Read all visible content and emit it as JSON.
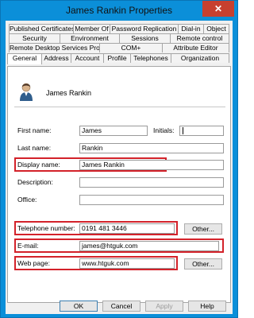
{
  "window": {
    "title": "James Rankin Properties",
    "close_glyph": "✕"
  },
  "tabs": {
    "row1": [
      "Published Certificates",
      "Member Of",
      "Password Replication",
      "Dial-in",
      "Object"
    ],
    "row2": [
      "Security",
      "Environment",
      "Sessions",
      "Remote control"
    ],
    "row3": [
      "Remote Desktop Services Profile",
      "COM+",
      "Attribute Editor"
    ],
    "row4": [
      "General",
      "Address",
      "Account",
      "Profile",
      "Telephones",
      "Organization"
    ],
    "active": "General"
  },
  "general": {
    "user_icon": "user-icon",
    "display_title": "James Rankin",
    "labels": {
      "first_name": "First name:",
      "initials": "Initials:",
      "last_name": "Last name:",
      "display_name": "Display name:",
      "description": "Description:",
      "office": "Office:",
      "telephone": "Telephone number:",
      "email": "E-mail:",
      "web_page": "Web page:"
    },
    "values": {
      "first_name": "James",
      "initials": "",
      "last_name": "Rankin",
      "display_name": "James Rankin",
      "description": "",
      "office": "",
      "telephone": "0191 481 3446",
      "email": "james@htguk.com",
      "web_page": "www.htguk.com"
    },
    "other_label": "Other..."
  },
  "footer": {
    "ok": "OK",
    "cancel": "Cancel",
    "apply": "Apply",
    "help": "Help"
  },
  "colors": {
    "title_bg": "#0b8fd9",
    "close_bg": "#c7402f",
    "highlight": "#d3222a"
  }
}
